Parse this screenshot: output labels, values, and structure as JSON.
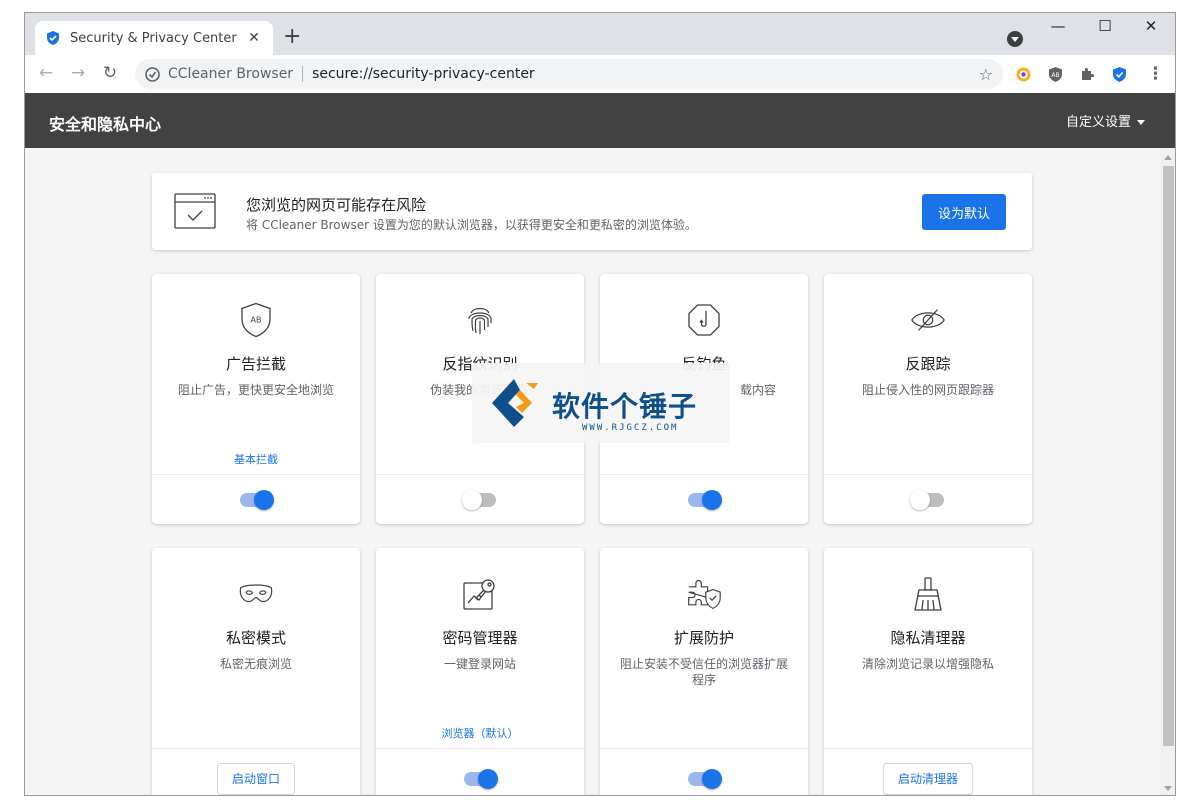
{
  "browser": {
    "tab_title": "Security & Privacy Center",
    "tab_close": "✕",
    "new_tab": "+",
    "win_minimize": "—",
    "win_maximize": "☐",
    "win_close": "✕",
    "back": "←",
    "forward": "→",
    "reload": "↻",
    "omnibox_brand": "CCleaner Browser",
    "omnibox_url": "secure://security-privacy-center",
    "star": "☆",
    "menu": "⋮"
  },
  "header": {
    "title": "安全和隐私中心",
    "custom_settings": "自定义设置"
  },
  "banner": {
    "heading": "您浏览的网页可能存在风险",
    "text": "将 CCleaner Browser 设置为您的默认浏览器，以获得更安全和更私密的浏览体验。",
    "button": "设为默认"
  },
  "cards": [
    {
      "title": "广告拦截",
      "desc": "阻止广告，更快更安全地浏览",
      "link": "基本拦截",
      "icon": "shield-ab-icon",
      "control": "toggle",
      "on": true
    },
    {
      "title": "反指纹识别",
      "desc": "伪装我的浏览 制在",
      "link": "",
      "icon": "fingerprint-icon",
      "control": "toggle",
      "on": false
    },
    {
      "title": "反钓鱼",
      "desc": "载内容",
      "link": "",
      "icon": "fishhook-icon",
      "control": "toggle",
      "on": true
    },
    {
      "title": "反跟踪",
      "desc": "阻止侵入性的网页跟踪器",
      "link": "",
      "icon": "eye-off-icon",
      "control": "toggle",
      "on": false
    },
    {
      "title": "私密模式",
      "desc": "私密无痕浏览",
      "link": "",
      "icon": "mask-icon",
      "control": "button",
      "button": "启动窗口"
    },
    {
      "title": "密码管理器",
      "desc": "一键登录网站",
      "link": "浏览器（默认）",
      "icon": "key-icon",
      "control": "toggle",
      "on": true
    },
    {
      "title": "扩展防护",
      "desc": "阻止安装不受信任的浏览器扩展程序",
      "link": "",
      "icon": "puzzle-shield-icon",
      "control": "toggle",
      "on": true
    },
    {
      "title": "隐私清理器",
      "desc": "清除浏览记录以增强隐私",
      "link": "",
      "icon": "broom-icon",
      "control": "button",
      "button": "启动清理器"
    }
  ],
  "watermark": {
    "title": "软件个锤子",
    "url": "WWW.RJGCZ.COM"
  },
  "colors": {
    "accent": "#1a73e8",
    "header_bg": "#424242",
    "page_bg": "#f5f5f5"
  }
}
